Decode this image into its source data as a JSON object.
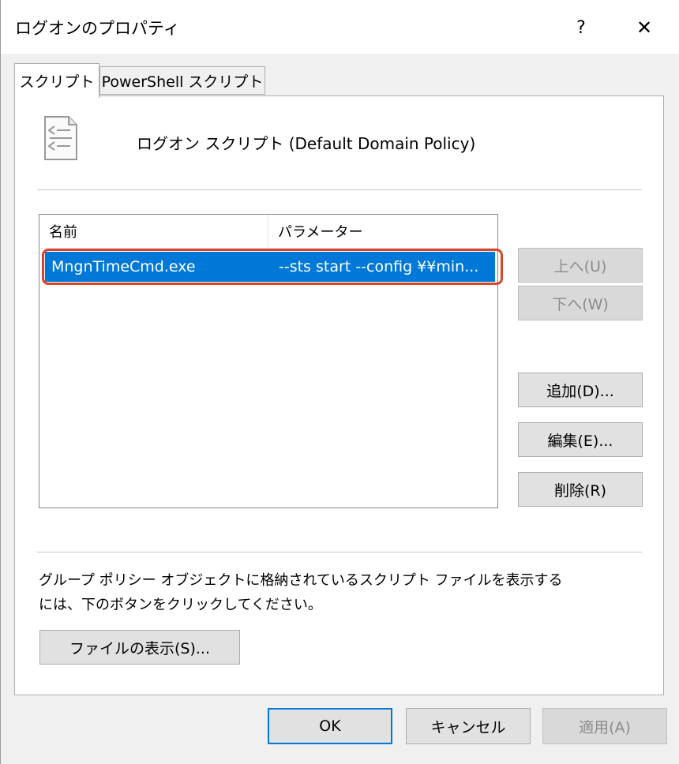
{
  "window": {
    "title": "ログオンのプロパティ",
    "help_glyph": "?",
    "close_glyph": "✕"
  },
  "tabs": [
    {
      "label": "スクリプト",
      "active": true
    },
    {
      "label": "PowerShell スクリプト",
      "active": false
    }
  ],
  "heading": "ログオン スクリプト (Default Domain Policy)",
  "list": {
    "columns": [
      "名前",
      "パラメーター"
    ],
    "rows": [
      {
        "name": "MngnTimeCmd.exe",
        "params": "--sts start --config ¥¥min...",
        "selected": true
      }
    ]
  },
  "side_buttons": {
    "up": "上へ(U)",
    "down": "下へ(W)",
    "add": "追加(D)...",
    "edit": "編集(E)...",
    "delete": "削除(R)"
  },
  "info_text": {
    "line1": "グループ ポリシー オブジェクトに格納されているスクリプト ファイルを表示する",
    "line2": "には、下のボタンをクリックしてください。"
  },
  "show_files_button": "ファイルの表示(S)...",
  "footer": {
    "ok": "OK",
    "cancel": "キャンセル",
    "apply": "適用(A)"
  },
  "colors": {
    "selection": "#0078d7",
    "highlight_outline": "#d9472b"
  }
}
